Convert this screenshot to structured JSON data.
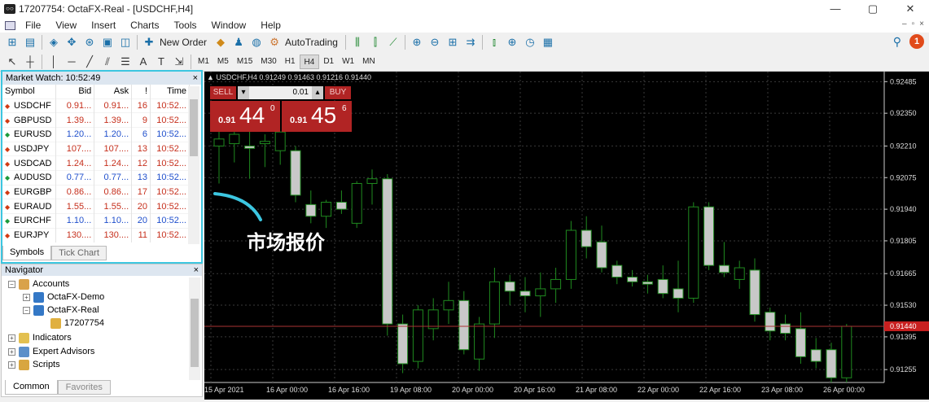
{
  "window": {
    "title": "17207754: OctaFX-Real - [USDCHF,H4]",
    "min": "—",
    "max": "▢",
    "close": "✕"
  },
  "menu": [
    "File",
    "View",
    "Insert",
    "Charts",
    "Tools",
    "Window",
    "Help"
  ],
  "toolbar": {
    "new_order": "New Order",
    "autotrading": "AutoTrading",
    "alert_count": "1"
  },
  "timeframes": [
    "M1",
    "M5",
    "M15",
    "M30",
    "H1",
    "H4",
    "D1",
    "W1",
    "MN"
  ],
  "active_timeframe": "H4",
  "market_watch": {
    "title": "Market Watch: 10:52:49",
    "close": "×",
    "columns": [
      "Symbol",
      "Bid",
      "Ask",
      "!",
      "Time"
    ],
    "rows": [
      {
        "symbol": "USDCHF",
        "bid": "0.91...",
        "ask": "0.91...",
        "spread": "16",
        "time": "10:52...",
        "dir": "down"
      },
      {
        "symbol": "GBPUSD",
        "bid": "1.39...",
        "ask": "1.39...",
        "spread": "9",
        "time": "10:52...",
        "dir": "down"
      },
      {
        "symbol": "EURUSD",
        "bid": "1.20...",
        "ask": "1.20...",
        "spread": "6",
        "time": "10:52...",
        "dir": "up"
      },
      {
        "symbol": "USDJPY",
        "bid": "107....",
        "ask": "107....",
        "spread": "13",
        "time": "10:52...",
        "dir": "down"
      },
      {
        "symbol": "USDCAD",
        "bid": "1.24...",
        "ask": "1.24...",
        "spread": "12",
        "time": "10:52...",
        "dir": "down"
      },
      {
        "symbol": "AUDUSD",
        "bid": "0.77...",
        "ask": "0.77...",
        "spread": "13",
        "time": "10:52...",
        "dir": "up"
      },
      {
        "symbol": "EURGBP",
        "bid": "0.86...",
        "ask": "0.86...",
        "spread": "17",
        "time": "10:52...",
        "dir": "down"
      },
      {
        "symbol": "EURAUD",
        "bid": "1.55...",
        "ask": "1.55...",
        "spread": "20",
        "time": "10:52...",
        "dir": "down"
      },
      {
        "symbol": "EURCHF",
        "bid": "1.10...",
        "ask": "1.10...",
        "spread": "20",
        "time": "10:52...",
        "dir": "up"
      },
      {
        "symbol": "EURJPY",
        "bid": "130....",
        "ask": "130....",
        "spread": "11",
        "time": "10:52...",
        "dir": "down"
      }
    ],
    "tabs": [
      "Symbols",
      "Tick Chart"
    ]
  },
  "navigator": {
    "title": "Navigator",
    "close": "×",
    "items": [
      "Accounts",
      "OctaFX-Demo",
      "OctaFX-Real",
      "17207754",
      "Indicators",
      "Expert Advisors",
      "Scripts"
    ],
    "tabs": [
      "Common",
      "Favorites"
    ]
  },
  "chart": {
    "info": "▲ USDCHF,H4  0.91249 0.91463 0.91216 0.91440",
    "sell": "SELL",
    "buy": "BUY",
    "volume": "0.01",
    "sell_small": "0.91",
    "sell_big": "44",
    "sell_sup": "0",
    "buy_small": "0.91",
    "buy_big": "45",
    "buy_sup": "6",
    "current_price": "0.91440",
    "annotation": "市场报价"
  },
  "chart_data": {
    "type": "candlestick",
    "symbol": "USDCHF",
    "timeframe": "H4",
    "y_ticks": [
      0.92485,
      0.9235,
      0.9221,
      0.92075,
      0.9194,
      0.91805,
      0.91665,
      0.9153,
      0.91395,
      0.91255
    ],
    "y_tick_labels": [
      "0.92485",
      "0.92350",
      "0.92210",
      "0.92075",
      "0.91940",
      "0.91805",
      "0.91665",
      "0.91530",
      "0.91395",
      "0.91255"
    ],
    "x_tick_labels": [
      "15 Apr 2021",
      "16 Apr 00:00",
      "16 Apr 16:00",
      "19 Apr 08:00",
      "20 Apr 00:00",
      "20 Apr 16:00",
      "21 Apr 08:00",
      "22 Apr 00:00",
      "22 Apr 16:00",
      "23 Apr 08:00",
      "26 Apr 00:00"
    ],
    "ylim": [
      0.912,
      0.925
    ],
    "candles": [
      {
        "o": 0.9221,
        "h": 0.9228,
        "l": 0.9205,
        "c": 0.9224
      },
      {
        "o": 0.9222,
        "h": 0.9229,
        "l": 0.9214,
        "c": 0.9226
      },
      {
        "o": 0.9221,
        "h": 0.9228,
        "l": 0.9207,
        "c": 0.922
      },
      {
        "o": 0.9222,
        "h": 0.9226,
        "l": 0.9212,
        "c": 0.9223
      },
      {
        "o": 0.9219,
        "h": 0.9226,
        "l": 0.9213,
        "c": 0.9227
      },
      {
        "o": 0.9219,
        "h": 0.9221,
        "l": 0.9197,
        "c": 0.92
      },
      {
        "o": 0.9196,
        "h": 0.9202,
        "l": 0.9188,
        "c": 0.9191
      },
      {
        "o": 0.9191,
        "h": 0.9198,
        "l": 0.9186,
        "c": 0.9197
      },
      {
        "o": 0.9197,
        "h": 0.9202,
        "l": 0.9192,
        "c": 0.9194
      },
      {
        "o": 0.9188,
        "h": 0.9206,
        "l": 0.9186,
        "c": 0.9205
      },
      {
        "o": 0.9205,
        "h": 0.9211,
        "l": 0.9196,
        "c": 0.9207
      },
      {
        "o": 0.9207,
        "h": 0.9209,
        "l": 0.914,
        "c": 0.9145
      },
      {
        "o": 0.9145,
        "h": 0.9149,
        "l": 0.9124,
        "c": 0.9128
      },
      {
        "o": 0.9129,
        "h": 0.9153,
        "l": 0.9126,
        "c": 0.9151
      },
      {
        "o": 0.9143,
        "h": 0.9156,
        "l": 0.9138,
        "c": 0.9151
      },
      {
        "o": 0.9151,
        "h": 0.9163,
        "l": 0.9145,
        "c": 0.9155
      },
      {
        "o": 0.9155,
        "h": 0.9159,
        "l": 0.9132,
        "c": 0.9134
      },
      {
        "o": 0.913,
        "h": 0.9148,
        "l": 0.9125,
        "c": 0.9145
      },
      {
        "o": 0.9145,
        "h": 0.9169,
        "l": 0.9139,
        "c": 0.9163
      },
      {
        "o": 0.9163,
        "h": 0.9166,
        "l": 0.9153,
        "c": 0.9159
      },
      {
        "o": 0.9159,
        "h": 0.9165,
        "l": 0.915,
        "c": 0.9157
      },
      {
        "o": 0.9157,
        "h": 0.9167,
        "l": 0.9148,
        "c": 0.916
      },
      {
        "o": 0.916,
        "h": 0.9169,
        "l": 0.9154,
        "c": 0.9164
      },
      {
        "o": 0.9164,
        "h": 0.9189,
        "l": 0.916,
        "c": 0.9185
      },
      {
        "o": 0.9185,
        "h": 0.9191,
        "l": 0.9173,
        "c": 0.9178
      },
      {
        "o": 0.918,
        "h": 0.9187,
        "l": 0.9167,
        "c": 0.9169
      },
      {
        "o": 0.917,
        "h": 0.9172,
        "l": 0.9162,
        "c": 0.9165
      },
      {
        "o": 0.9165,
        "h": 0.9168,
        "l": 0.9161,
        "c": 0.9163
      },
      {
        "o": 0.9163,
        "h": 0.9166,
        "l": 0.9158,
        "c": 0.9162
      },
      {
        "o": 0.9164,
        "h": 0.917,
        "l": 0.9156,
        "c": 0.9158
      },
      {
        "o": 0.916,
        "h": 0.9172,
        "l": 0.915,
        "c": 0.9156
      },
      {
        "o": 0.9156,
        "h": 0.9197,
        "l": 0.9154,
        "c": 0.9195
      },
      {
        "o": 0.9195,
        "h": 0.9197,
        "l": 0.9168,
        "c": 0.917
      },
      {
        "o": 0.917,
        "h": 0.918,
        "l": 0.9165,
        "c": 0.9167
      },
      {
        "o": 0.9164,
        "h": 0.9172,
        "l": 0.916,
        "c": 0.9169
      },
      {
        "o": 0.9168,
        "h": 0.9173,
        "l": 0.9146,
        "c": 0.9149
      },
      {
        "o": 0.915,
        "h": 0.9152,
        "l": 0.9138,
        "c": 0.9142
      },
      {
        "o": 0.9145,
        "h": 0.9149,
        "l": 0.9138,
        "c": 0.9141
      },
      {
        "o": 0.9143,
        "h": 0.915,
        "l": 0.9128,
        "c": 0.9131
      },
      {
        "o": 0.9134,
        "h": 0.9139,
        "l": 0.9126,
        "c": 0.9129
      },
      {
        "o": 0.9134,
        "h": 0.9137,
        "l": 0.912,
        "c": 0.9122
      },
      {
        "o": 0.9122,
        "h": 0.9145,
        "l": 0.912,
        "c": 0.9144
      }
    ]
  }
}
